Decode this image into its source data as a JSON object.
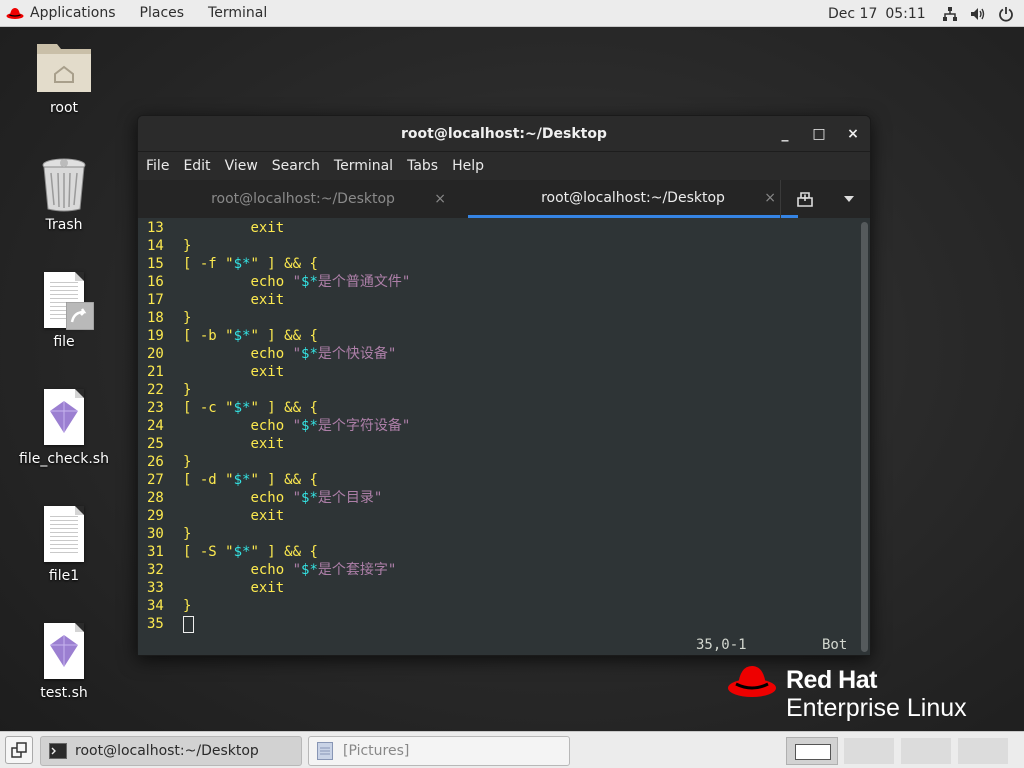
{
  "topbar": {
    "applications": "Applications",
    "places": "Places",
    "terminal": "Terminal",
    "date": "Dec 17",
    "time": "05:11",
    "icons": [
      "network-icon",
      "volume-icon",
      "power-icon"
    ]
  },
  "desktop": {
    "icons": [
      {
        "label": "root",
        "icon": "home-folder-icon"
      },
      {
        "label": "Trash",
        "icon": "trash-icon"
      },
      {
        "label": "file",
        "icon": "symlink-file-icon"
      },
      {
        "label": "file_check.sh",
        "icon": "script-icon"
      },
      {
        "label": "file1",
        "icon": "text-file-icon"
      },
      {
        "label": "test.sh",
        "icon": "script-icon"
      }
    ]
  },
  "window": {
    "title": "root@localhost:~/Desktop",
    "minimize": "_",
    "maximize": "□",
    "close": "×",
    "menu": [
      "File",
      "Edit",
      "View",
      "Search",
      "Terminal",
      "Tabs",
      "Help"
    ],
    "tabs": [
      {
        "label": "root@localhost:~/Desktop",
        "active": false
      },
      {
        "label": "root@localhost:~/Desktop",
        "active": true
      }
    ],
    "tab_close": "×"
  },
  "editor": {
    "lines": [
      {
        "n": "13",
        "segs": [
          [
            "w",
            "        "
          ],
          [
            "y",
            "exit"
          ]
        ]
      },
      {
        "n": "14",
        "segs": [
          [
            "y",
            "}"
          ]
        ]
      },
      {
        "n": "15",
        "segs": [
          [
            "y",
            "[ -f \""
          ],
          [
            "c",
            "$*"
          ],
          [
            "y",
            "\" ] && {"
          ]
        ]
      },
      {
        "n": "16",
        "segs": [
          [
            "w",
            "        "
          ],
          [
            "y",
            "echo "
          ],
          [
            "p",
            "\""
          ],
          [
            "c",
            "$*"
          ],
          [
            "p",
            "是个普通文件\""
          ]
        ]
      },
      {
        "n": "17",
        "segs": [
          [
            "w",
            "        "
          ],
          [
            "y",
            "exit"
          ]
        ]
      },
      {
        "n": "18",
        "segs": [
          [
            "y",
            "}"
          ]
        ]
      },
      {
        "n": "19",
        "segs": [
          [
            "y",
            "[ -b \""
          ],
          [
            "c",
            "$*"
          ],
          [
            "y",
            "\" ] && {"
          ]
        ]
      },
      {
        "n": "20",
        "segs": [
          [
            "w",
            "        "
          ],
          [
            "y",
            "echo "
          ],
          [
            "p",
            "\""
          ],
          [
            "c",
            "$*"
          ],
          [
            "p",
            "是个快设备\""
          ]
        ]
      },
      {
        "n": "21",
        "segs": [
          [
            "w",
            "        "
          ],
          [
            "y",
            "exit"
          ]
        ]
      },
      {
        "n": "22",
        "segs": [
          [
            "y",
            "}"
          ]
        ]
      },
      {
        "n": "23",
        "segs": [
          [
            "y",
            "[ -c \""
          ],
          [
            "c",
            "$*"
          ],
          [
            "y",
            "\" ] && {"
          ]
        ]
      },
      {
        "n": "24",
        "segs": [
          [
            "w",
            "        "
          ],
          [
            "y",
            "echo "
          ],
          [
            "p",
            "\""
          ],
          [
            "c",
            "$*"
          ],
          [
            "p",
            "是个字符设备\""
          ]
        ]
      },
      {
        "n": "25",
        "segs": [
          [
            "w",
            "        "
          ],
          [
            "y",
            "exit"
          ]
        ]
      },
      {
        "n": "26",
        "segs": [
          [
            "y",
            "}"
          ]
        ]
      },
      {
        "n": "27",
        "segs": [
          [
            "y",
            "[ -d \""
          ],
          [
            "c",
            "$*"
          ],
          [
            "y",
            "\" ] && {"
          ]
        ]
      },
      {
        "n": "28",
        "segs": [
          [
            "w",
            "        "
          ],
          [
            "y",
            "echo "
          ],
          [
            "p",
            "\""
          ],
          [
            "c",
            "$*"
          ],
          [
            "p",
            "是个目录\""
          ]
        ]
      },
      {
        "n": "29",
        "segs": [
          [
            "w",
            "        "
          ],
          [
            "y",
            "exit"
          ]
        ]
      },
      {
        "n": "30",
        "segs": [
          [
            "y",
            "}"
          ]
        ]
      },
      {
        "n": "31",
        "segs": [
          [
            "y",
            "[ -S \""
          ],
          [
            "c",
            "$*"
          ],
          [
            "y",
            "\" ] && {"
          ]
        ]
      },
      {
        "n": "32",
        "segs": [
          [
            "w",
            "        "
          ],
          [
            "y",
            "echo "
          ],
          [
            "p",
            "\""
          ],
          [
            "c",
            "$*"
          ],
          [
            "p",
            "是个套接字\""
          ]
        ]
      },
      {
        "n": "33",
        "segs": [
          [
            "w",
            "        "
          ],
          [
            "y",
            "exit"
          ]
        ]
      },
      {
        "n": "34",
        "segs": [
          [
            "y",
            "}"
          ]
        ]
      },
      {
        "n": "35",
        "segs": []
      }
    ],
    "position": "35,0-1",
    "scroll": "Bot"
  },
  "logo": {
    "brand": "Red Hat",
    "product": "Enterprise Linux"
  },
  "panel": {
    "tasks": [
      {
        "label": "root@localhost:~/Desktop",
        "icon": "terminal-icon"
      },
      {
        "label": "[Pictures]",
        "icon": "file-manager-icon"
      }
    ]
  },
  "colors": {
    "terminal_bg": "#2e3436",
    "yellow": "#fce94f",
    "cyan": "#34e2e2",
    "purple": "#ad7fa8",
    "tab_accent": "#3584e4",
    "redhat_red": "#ee0000"
  }
}
